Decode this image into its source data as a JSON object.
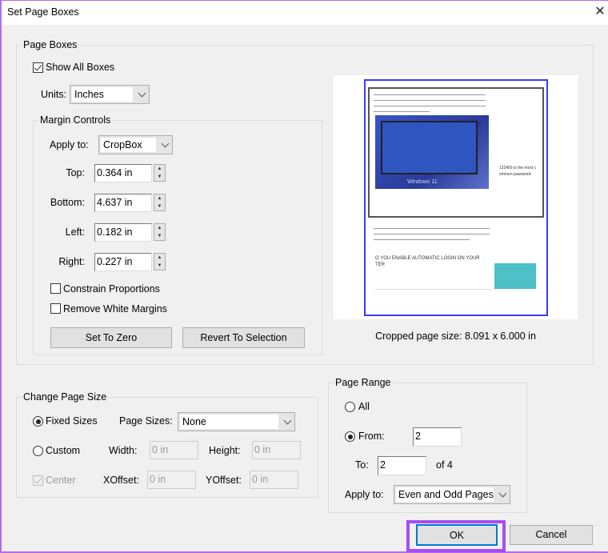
{
  "window": {
    "title": "Set Page Boxes",
    "close_icon": "close-icon",
    "accent": "#b36cf0"
  },
  "page_boxes": {
    "label": "Page Boxes",
    "show_all_boxes": {
      "label": "Show All Boxes",
      "checked": true
    },
    "units": {
      "label": "Units:",
      "value": "Inches"
    },
    "margin_controls": {
      "label": "Margin Controls",
      "apply_to": {
        "label": "Apply to:",
        "value": "CropBox"
      },
      "top": {
        "label": "Top:",
        "value": "0.364 in"
      },
      "bottom": {
        "label": "Bottom:",
        "value": "4.637 in"
      },
      "left": {
        "label": "Left:",
        "value": "0.182 in"
      },
      "right": {
        "label": "Right:",
        "value": "0.227 in"
      },
      "constrain": {
        "label": "Constrain Proportions",
        "checked": false
      },
      "remove_white": {
        "label": "Remove White Margins",
        "checked": false
      },
      "set_zero": "Set To Zero",
      "revert": "Revert To Selection"
    },
    "preview": {
      "heading_line1": "O YOU ENABLE AUTOMATIC LOGIN ON YOUR",
      "heading_line2": "TER",
      "side_text1": "123456 is the most c",
      "side_text2": "ommon password.",
      "image_caption": "Windows 11",
      "crop_color": "#3b3bff"
    },
    "cropped_size": "Cropped page size: 8.091 x 6.000 in"
  },
  "change_page_size": {
    "label": "Change Page Size",
    "fixed": {
      "label": "Fixed Sizes",
      "selected": true
    },
    "page_sizes": {
      "label": "Page Sizes:",
      "value": "None"
    },
    "custom": {
      "label": "Custom",
      "selected": false
    },
    "width": {
      "label": "Width:",
      "value": "0 in"
    },
    "height": {
      "label": "Height:",
      "value": "0 in"
    },
    "center": {
      "label": "Center",
      "checked": true,
      "disabled": true
    },
    "xoffset": {
      "label": "XOffset:",
      "value": "0 in"
    },
    "yoffset": {
      "label": "YOffset:",
      "value": "0 in"
    }
  },
  "page_range": {
    "label": "Page Range",
    "all": {
      "label": "All",
      "selected": false
    },
    "from": {
      "label": "From:",
      "selected": true,
      "value": "2"
    },
    "to": {
      "label": "To:",
      "value": "2"
    },
    "of": "of 4",
    "apply_to": {
      "label": "Apply to:",
      "value": "Even and Odd Pages"
    }
  },
  "buttons": {
    "ok": "OK",
    "cancel": "Cancel"
  }
}
